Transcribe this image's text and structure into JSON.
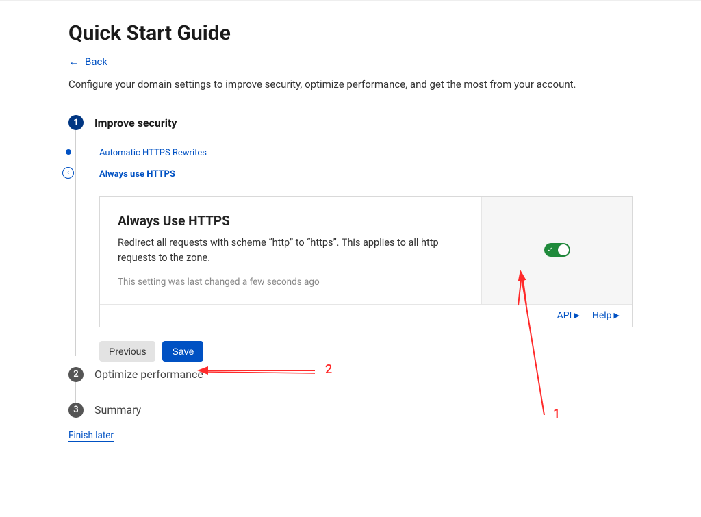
{
  "page": {
    "title": "Quick Start Guide",
    "back_label": "Back",
    "intro": "Configure your domain settings to improve security, optimize performance, and get the most from your account."
  },
  "steps": {
    "s1": {
      "num": "1",
      "title": "Improve security"
    },
    "s2": {
      "num": "2",
      "title": "Optimize performance"
    },
    "s3": {
      "num": "3",
      "title": "Summary"
    }
  },
  "substeps": {
    "auto_rewrites": "Automatic HTTPS Rewrites",
    "always_https": "Always use HTTPS"
  },
  "card": {
    "title": "Always Use HTTPS",
    "desc": "Redirect all requests with scheme “http” to “https”. This applies to all http requests to the zone.",
    "meta": "This setting was last changed a few seconds ago",
    "toggle_on": true,
    "footer": {
      "api": "API",
      "help": "Help"
    }
  },
  "buttons": {
    "previous": "Previous",
    "save": "Save"
  },
  "finish_later": "Finish later",
  "annotations": {
    "label1": "1",
    "label2": "2"
  }
}
